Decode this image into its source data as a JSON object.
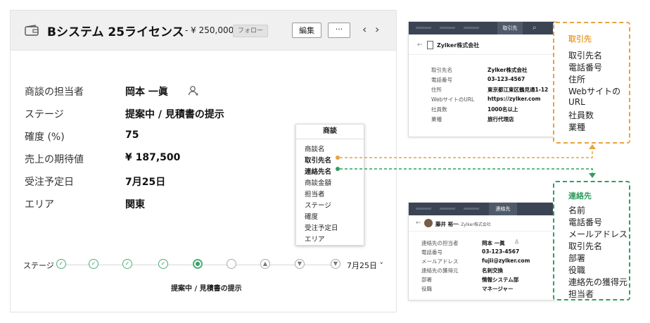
{
  "deal": {
    "title": "Bシステム 25ライセンス",
    "amount": "- ¥ 250,000",
    "follow": "フォロー",
    "edit": "編集",
    "more": "···",
    "prev": "‹",
    "next": "›"
  },
  "fields": [
    {
      "label": "商談の担当者",
      "value": "岡本 一眞"
    },
    {
      "label": "ステージ",
      "value": "提案中 / 見積書の提示"
    },
    {
      "label": "確度 (%)",
      "value": "75"
    },
    {
      "label": "売上の期待値",
      "value": "¥ 187,500"
    },
    {
      "label": "受注予定日",
      "value": "7月25日"
    },
    {
      "label": "エリア",
      "value": "関東"
    }
  ],
  "stage": {
    "label": "ステージ",
    "date": "7月25日 ˅",
    "caption": "提案中 / 見積書の提示"
  },
  "deal_popup": {
    "title": "商談",
    "items": [
      "商談名",
      "取引先名",
      "連絡先名",
      "商談金額",
      "担当者",
      "ステージ",
      "確度",
      "受注予定日",
      "エリア"
    ]
  },
  "account_window": {
    "tab": "取引先",
    "name": "Zylker株式会社",
    "rows": [
      {
        "label": "取引先名",
        "value": "Zylker株式会社"
      },
      {
        "label": "電話番号",
        "value": "03-123-4567"
      },
      {
        "label": "住所",
        "value": "東京都江東区鶴見通1-12"
      },
      {
        "label": "WebサイトのURL",
        "value": "https://zylker.com"
      },
      {
        "label": "社員数",
        "value": "1000名以上"
      },
      {
        "label": "業種",
        "value": "旅行代理店"
      }
    ]
  },
  "contact_window": {
    "tab": "連絡先",
    "name": "藤井 裕一",
    "company": "- Zylker株式会社",
    "rows": [
      {
        "label": "連絡先の担当者",
        "value": "岡本 一眞"
      },
      {
        "label": "電話番号",
        "value": "03-123-4567"
      },
      {
        "label": "メールアドレス",
        "value": "fujii@zylker.com"
      },
      {
        "label": "連絡先の獲得元",
        "value": "名刺交換"
      },
      {
        "label": "部署",
        "value": "情報システム部"
      },
      {
        "label": "役職",
        "value": "マネージャー"
      }
    ]
  },
  "account_callout": {
    "title": "取引先",
    "items": [
      "取引先名",
      "電話番号",
      "住所",
      "Webサイトの",
      "URL",
      "社員数",
      "業種"
    ]
  },
  "contact_callout": {
    "title": "連絡先",
    "items": [
      "名前",
      "電話番号",
      "メールアドレス",
      "取引先名",
      "部署",
      "役職",
      "連絡先の獲得元",
      "担当者"
    ]
  },
  "colors": {
    "orange": "#e8a33d",
    "green": "#2e9f5f",
    "header": "#3a4452"
  }
}
